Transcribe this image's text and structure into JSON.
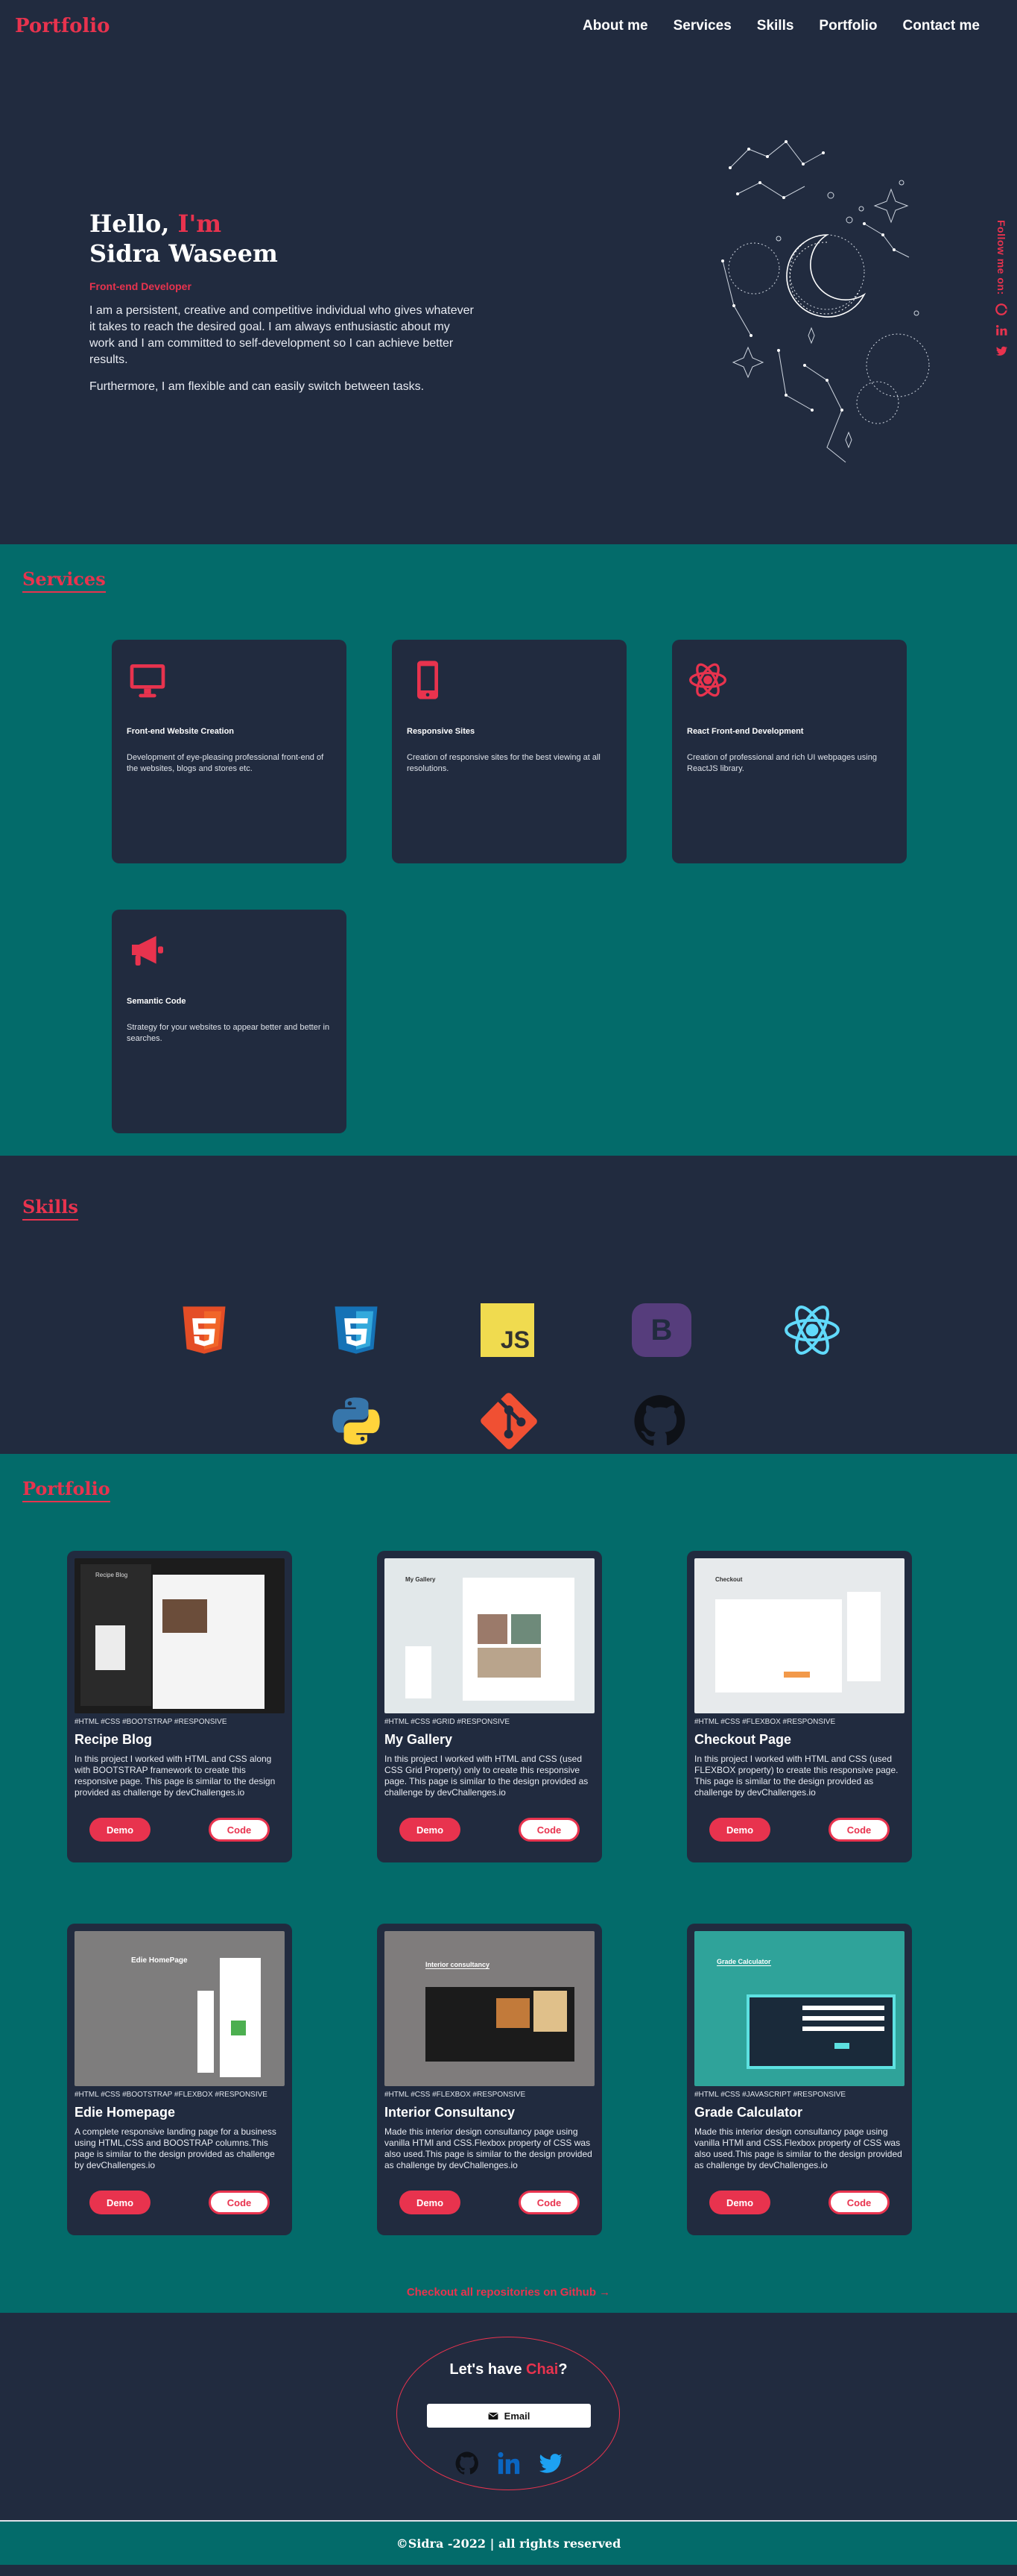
{
  "nav": {
    "logo": "Portfolio",
    "links": [
      "About me",
      "Services",
      "Skills",
      "Portfolio",
      "Contact me"
    ]
  },
  "hero": {
    "greeting": "Hello,",
    "greeting_accent": "I'm",
    "name": "Sidra Waseem",
    "role": "Front-end Developer",
    "paragraph1": "I am a persistent, creative and competitive individual who gives whatever it takes to reach the desired goal. I am always enthusiastic about my work and I am committed to self-development so I can achieve better results.",
    "paragraph2": "Furthermore, I am flexible and can easily switch between tasks.",
    "follow_label": "Follow me on:",
    "follow_icons": [
      "github-icon",
      "linkedin-icon",
      "twitter-icon"
    ]
  },
  "services": {
    "title": "Services",
    "items": [
      {
        "icon": "monitor-icon",
        "title": "Front-end Website Creation",
        "desc": "Development of eye-pleasing professional front-end of the websites, blogs and stores etc."
      },
      {
        "icon": "mobile-icon",
        "title": "Responsive Sites",
        "desc": "Creation of responsive sites for the best viewing at all resolutions."
      },
      {
        "icon": "react-icon",
        "title": "React Front-end Development",
        "desc": "Creation of professional and rich UI webpages using ReactJS library."
      },
      {
        "icon": "megaphone-icon",
        "title": "Semantic Code",
        "desc": "Strategy for your websites to appear better and better in searches."
      }
    ]
  },
  "skills": {
    "title": "Skills",
    "icons": [
      "html5-icon",
      "css3-icon",
      "javascript-icon",
      "bootstrap-icon",
      "react-icon",
      "python-icon",
      "git-icon",
      "github-icon"
    ],
    "js_text": "JS",
    "bootstrap_text": "B"
  },
  "portfolio": {
    "title": "Portfolio",
    "demo_label": "Demo",
    "code_label": "Code",
    "projects": [
      {
        "tags": "#HTML #CSS #BOOTSTRAP #RESPONSIVE",
        "title": "Recipe Blog",
        "desc": "In this project I worked with HTML and CSS along with BOOTSTRAP framework to create this responsive page. This page is similar to the design provided as challenge by devChallenges.io",
        "thumb_text": "Recipe Blog"
      },
      {
        "tags": "#HTML #CSS #GRID #RESPONSIVE",
        "title": "My Gallery",
        "desc": "In this project I worked with HTML and CSS (used CSS Grid Property) only to create this responsive page. This page is similar to the design provided as challenge by devChallenges.io",
        "thumb_text": "My Gallery"
      },
      {
        "tags": "#HTML #CSS #FLEXBOX #RESPONSIVE",
        "title": "Checkout Page",
        "desc": "In this project I worked with HTML and CSS (used FLEXBOX property) to create this responsive page. This page is similar to the design provided as challenge by devChallenges.io",
        "thumb_text": "Checkout"
      },
      {
        "tags": "#HTML #CSS #BOOTSTRAP #FLEXBOX #RESPONSIVE",
        "title": "Edie Homepage",
        "desc": "A complete responsive landing page for a business using HTML,CSS and BOOSTRAP columns.This page is similar to the design provided as challenge by devChallenges.io",
        "thumb_text": "Edie HomePage"
      },
      {
        "tags": "#HTML #CSS #FLEXBOX #RESPONSIVE",
        "title": "Interior Consultancy",
        "desc": "Made this interior design consultancy page using vanilla HTMl and CSS.Flexbox property of CSS was also used.This page is similar to the design provided as challenge by devChallenges.io",
        "thumb_text": "Interior consultancy"
      },
      {
        "tags": "#HTML #CSS #JAVASCRIPT #RESPONSIVE",
        "title": "Grade Calculator",
        "desc": "Made this interior design consultancy page using vanilla HTMl and CSS.Flexbox property of CSS was also used.This page is similar to the design provided as challenge by devChallenges.io",
        "thumb_text": "Grade Calculator"
      }
    ],
    "repo_link": "Checkout all repositories on Github →"
  },
  "contact": {
    "title_start": "Let's have",
    "title_accent": "Chai",
    "title_end": "?",
    "email_label": "Email",
    "icons": [
      "github-icon",
      "linkedin-icon",
      "twitter-icon"
    ]
  },
  "footer": {
    "text": "©Sidra -2022 | all rights reserved"
  },
  "colors": {
    "accent": "#e8334e",
    "navy": "#212b3f",
    "teal": "#036b6a"
  }
}
